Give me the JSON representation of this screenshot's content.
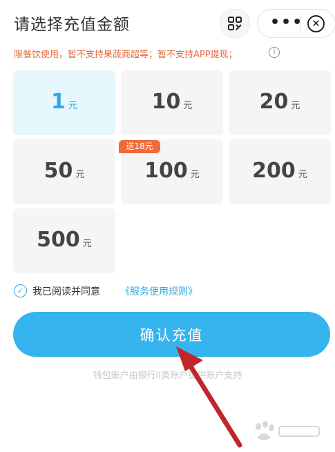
{
  "header": {
    "title": "请选择充值金额",
    "scan_icon": "scan-icon",
    "more_icon": "•••",
    "close_icon": "✕"
  },
  "notice": "限餐饮使用，暂不支持果蔬商超等；暂不支持APP提现；",
  "info_icon": "i",
  "amounts": [
    {
      "amount": "1",
      "unit": "元",
      "selected": true
    },
    {
      "amount": "10",
      "unit": "元"
    },
    {
      "amount": "20",
      "unit": "元"
    },
    {
      "amount": "50",
      "unit": "元"
    },
    {
      "amount": "100",
      "unit": "元",
      "badge": "送18元"
    },
    {
      "amount": "200",
      "unit": "元"
    },
    {
      "amount": "500",
      "unit": "元"
    }
  ],
  "agreement": {
    "prefix": "我已阅读并同意",
    "link": "《服务使用规则》",
    "checked": true
  },
  "confirm_label": "确认充值",
  "footer_text": "钱包账户由银行II类账户提供账户支持",
  "colors": {
    "accent": "#35b4ee",
    "selected_tile": "#e5f6fd",
    "warning": "#e06a3c",
    "badge": "#f06a3a",
    "arrow": "#c0272d"
  }
}
